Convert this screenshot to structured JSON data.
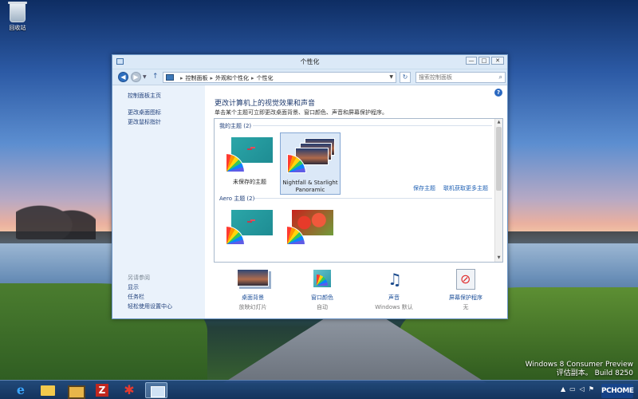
{
  "desktop": {
    "recycle_bin_label": "回收站",
    "watermark_line1": "Windows 8 Consumer Preview",
    "watermark_line2": "评估副本。 Build 8250"
  },
  "window": {
    "title": "个性化",
    "controls": {
      "minimize": "—",
      "maximize": "□",
      "close": "✕"
    }
  },
  "address": {
    "breadcrumb": [
      "控制面板",
      "外观和个性化",
      "个性化"
    ],
    "search_placeholder": "搜索控制面板"
  },
  "sidebar": {
    "home_link": "控制面板主页",
    "links": [
      "更改桌面图标",
      "更改鼠标指针"
    ],
    "see_also_heading": "另请参阅",
    "see_also": [
      "显示",
      "任务栏",
      "轻松使用设置中心"
    ]
  },
  "content": {
    "title": "更改计算机上的视觉效果和声音",
    "description": "单击某个主题可立即更改桌面背景、窗口颜色、声音和屏幕保护程序。",
    "my_themes_header": "我的主题 (2)",
    "my_themes": [
      {
        "label": "未保存的主题",
        "selected": false
      },
      {
        "label": "Nightfall & Starlight Panoramic",
        "selected": true
      }
    ],
    "save_theme_link": "保存主题",
    "get_more_link": "联机获取更多主题",
    "aero_header": "Aero 主题 (2)"
  },
  "bottom": [
    {
      "label": "桌面背景",
      "sub": "放映幻灯片",
      "icon": "desktop-background-icon"
    },
    {
      "label": "窗口颜色",
      "sub": "自动",
      "icon": "window-color-icon"
    },
    {
      "label": "声音",
      "sub": "Windows 默认",
      "icon": "sound-icon"
    },
    {
      "label": "屏幕保护程序",
      "sub": "无",
      "icon": "screensaver-icon"
    }
  ],
  "taskbar": {
    "logo": "PCHOME"
  },
  "colors": {
    "accent": "#2f6fbf",
    "link": "#1d4f99",
    "sidebar_bg": "#eaf2fb"
  }
}
